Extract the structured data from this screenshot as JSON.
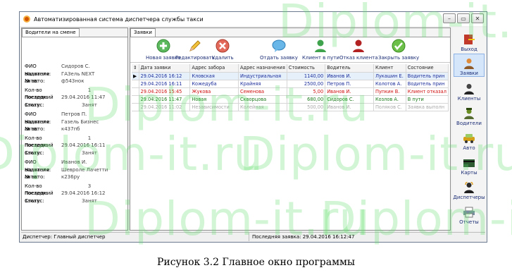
{
  "window": {
    "title": "Автоматизированная система диспетчера службы такси",
    "controls": [
      "minimize",
      "maximize",
      "close"
    ]
  },
  "left_panel": {
    "tab": "Водители на смене",
    "drivers": [
      {
        "fio_label": "ФИО водителя:",
        "fio": "Сидоров С.",
        "car_label": "Название авто:",
        "car": "ГАЗель NEXT",
        "num_label": "№ авто:",
        "num": "ф543нок",
        "trips_label": "Кол-во поездок:",
        "trips": "1",
        "last_label": "Последний заказ:",
        "last": "29.04.2016 11:47",
        "status_label": "Статус:",
        "status": "Занят"
      },
      {
        "fio_label": "ФИО водителя:",
        "fio": "Петров П.",
        "car_label": "Название авто:",
        "car": "Газель Бизнес",
        "num_label": "№ авто:",
        "num": "к437пб",
        "trips_label": "Кол-во поездок:",
        "trips": "1",
        "last_label": "Последний заказ:",
        "last": "29.04.2016 16:11",
        "status_label": "Статус:",
        "status": "Занят"
      },
      {
        "fio_label": "ФИО водителя:",
        "fio": "Иванов И.",
        "car_label": "Название авто:",
        "car": "Шевроле Лачетти",
        "num_label": "№ авто:",
        "num": "к236ру",
        "trips_label": "Кол-во поездок:",
        "trips": "3",
        "last_label": "Последний заказ:",
        "last": "29.04.2016 16:12",
        "status_label": "Статус:",
        "status": "Занят"
      }
    ]
  },
  "center_panel": {
    "tab": "Заявки",
    "toolbar": [
      {
        "label": "Новая заявка",
        "icon": "plus-icon"
      },
      {
        "label": "Редактировать",
        "icon": "pencil-icon"
      },
      {
        "label": "Удалить",
        "icon": "delete-icon"
      },
      {
        "label": "Отдать заявку",
        "icon": "speech-bubble-icon"
      },
      {
        "label": "Клиент в пути",
        "icon": "user-green-icon"
      },
      {
        "label": "Отказ клиента",
        "icon": "user-red-icon"
      },
      {
        "label": "Закрыть заявку",
        "icon": "check-icon"
      }
    ],
    "table": {
      "headers": [
        "",
        "Дата заявки",
        "Адрес забора",
        "Адрес назначения",
        "Стоимость",
        "Водитель",
        "Клиент",
        "Состояние"
      ],
      "rows": [
        {
          "date": "29.04.2016 16:12",
          "from": "Кловская",
          "to": "Индустриальная",
          "cost": "1140,00",
          "driver": "Иванов И.",
          "client": "Лукашин Е.",
          "state": "Водитель прин",
          "color": "#1b2d9a",
          "current": true
        },
        {
          "date": "29.04.2016 16:11",
          "from": "Кожедуба",
          "to": "Крайняя",
          "cost": "2500,00",
          "driver": "Петров П.",
          "client": "Колотов А.",
          "state": "Водитель прин",
          "color": "#1b2d9a",
          "current": false
        },
        {
          "date": "29.04.2016 15:45",
          "from": "Жукова",
          "to": "Семенова",
          "cost": "5,00",
          "driver": "Иванов И.",
          "client": "Пупкин В.",
          "state": "Клиент отказал",
          "color": "#d01010",
          "current": false
        },
        {
          "date": "29.04.2016 11:47",
          "from": "Новая",
          "to": "Скворцова",
          "cost": "680,00",
          "driver": "Сидоров С.",
          "client": "Козлов А.",
          "state": "В пути",
          "color": "#1a7a1a",
          "current": false
        },
        {
          "date": "29.04.2016 11:02",
          "from": "Независимости",
          "to": "Колейная",
          "cost": "500,00",
          "driver": "Иванов И.",
          "client": "Поляков С.",
          "state": "Заявка выполн",
          "color": "#a8a8a8",
          "current": false
        }
      ]
    }
  },
  "sidebar": [
    {
      "label": "Выход",
      "icon": "exit-icon"
    },
    {
      "label": "Заявки",
      "icon": "person-orange-icon",
      "active": true
    },
    {
      "label": "Клиенты",
      "icon": "person-dark-icon"
    },
    {
      "label": "Водители",
      "icon": "driver-icon"
    },
    {
      "label": "Авто",
      "icon": "car-icon"
    },
    {
      "label": "Карты",
      "icon": "card-icon"
    },
    {
      "label": "Диспетчеры",
      "icon": "dispatcher-icon"
    },
    {
      "label": "Отчеты",
      "icon": "printer-icon"
    }
  ],
  "statusbar": {
    "dispatcher": "Диспетчер: Главный диспетчер",
    "last_order": "Последняя заявка: 29.04.2016 16:12:47"
  },
  "caption": "Рисунок 3.2 Главное окно программы",
  "watermark": "Diplom-it.ru"
}
